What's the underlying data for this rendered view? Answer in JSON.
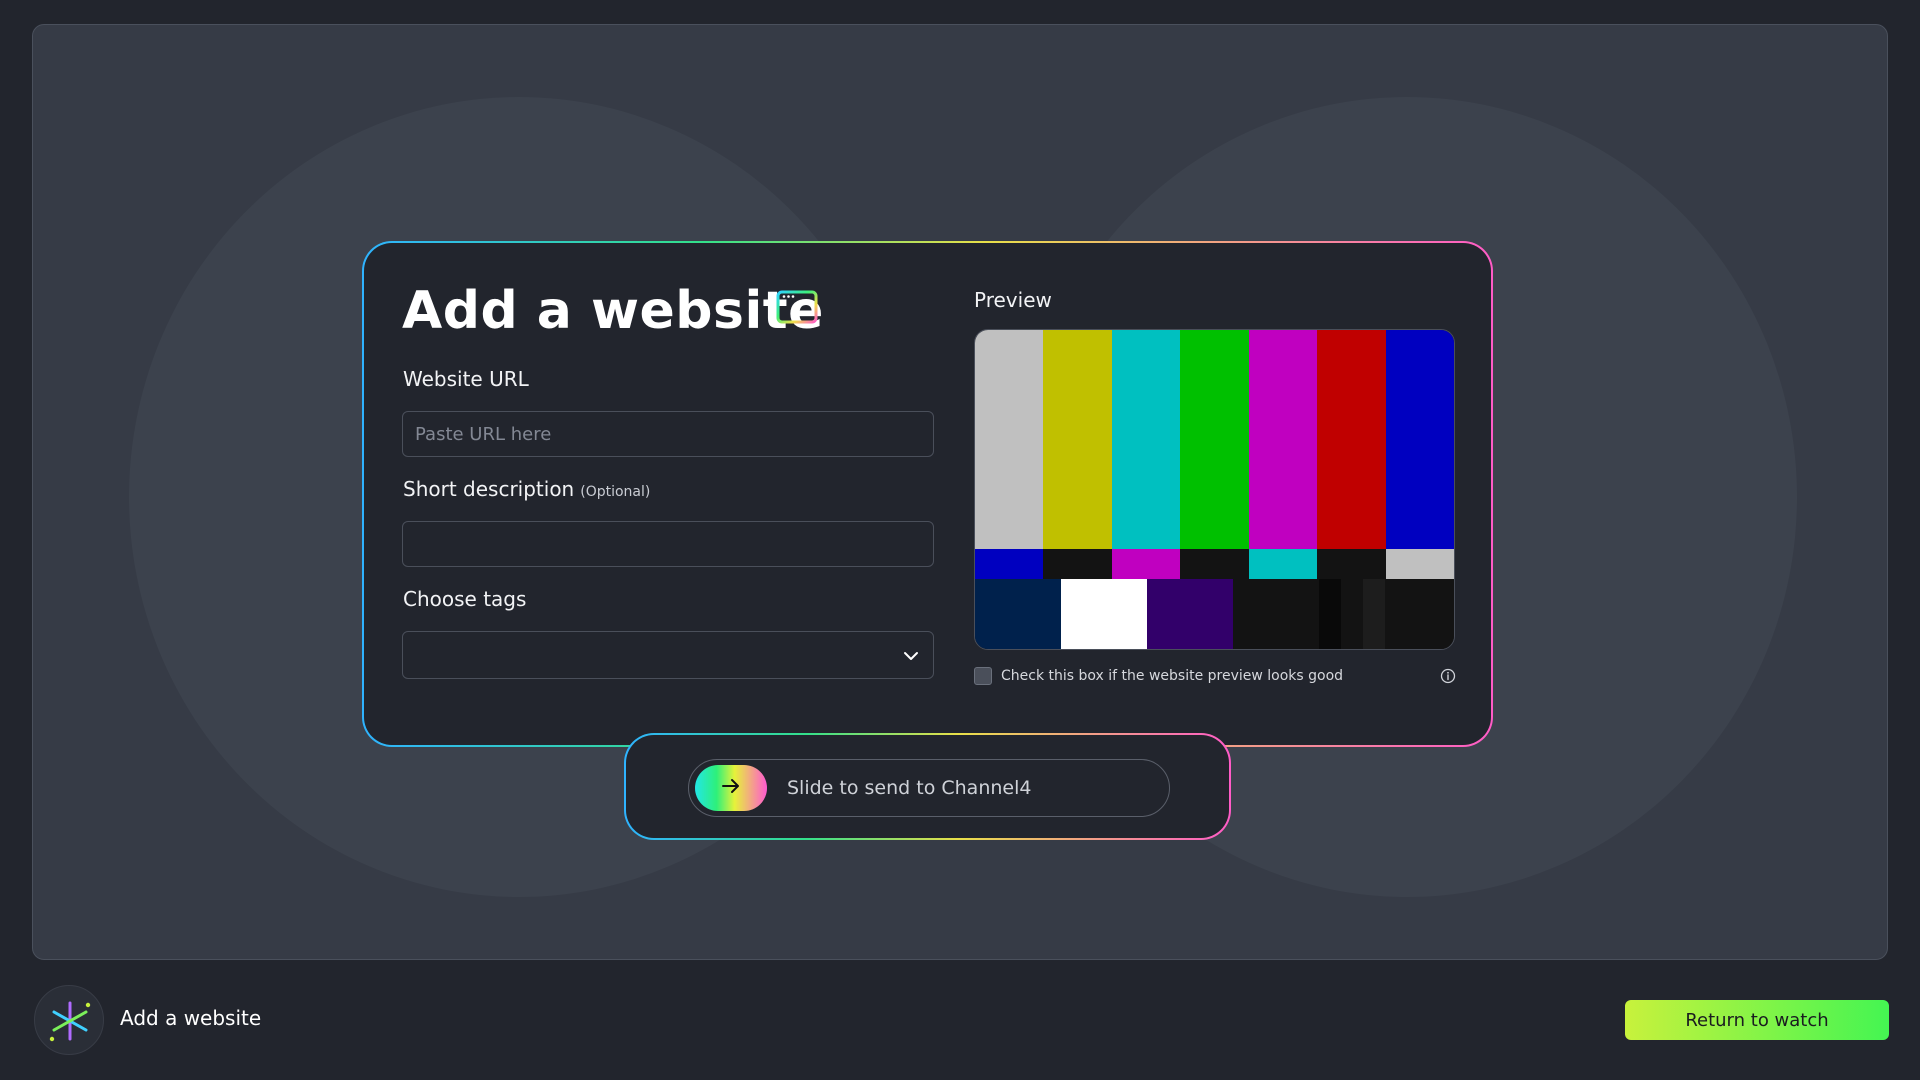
{
  "form": {
    "title": "Add a website",
    "title_icon": "browser-window-icon",
    "url_label": "Website URL",
    "url_placeholder": "Paste URL here",
    "url_value": "",
    "description_label": "Short description",
    "description_optional": "(Optional)",
    "description_value": "",
    "tags_label": "Choose tags",
    "tags_selected": "",
    "tags_icon": "chevron-down-icon"
  },
  "preview": {
    "label": "Preview",
    "top_bar_colors": [
      "#c0c0c0",
      "#c0c000",
      "#00c0c0",
      "#00c000",
      "#c000c0",
      "#c00000",
      "#0000c0"
    ],
    "mid_bar_colors": [
      "#0000c0",
      "#131313",
      "#c000c0",
      "#131313",
      "#00c0c0",
      "#131313",
      "#c0c0c0"
    ],
    "bottom_bar_colors": [
      "#00214c",
      "#ffffff",
      "#32006a",
      "#131313",
      "#131313",
      "#090909",
      "#131313",
      "#1d1d1d",
      "#131313"
    ],
    "checkbox_label": "Check this box if the website preview looks good",
    "checkbox_checked": false,
    "info_icon": "info-icon"
  },
  "slider": {
    "label": "Slide to send to Channel4",
    "knob_icon": "arrow-right-icon"
  },
  "footer": {
    "logo": "spark-logo-icon",
    "title": "Add a website",
    "return_label": "Return to watch"
  },
  "colors": {
    "background": "#22252d",
    "stage": "#363b46",
    "accent_gradient": [
      "#2fb3ff",
      "#33e08a",
      "#e8e049",
      "#ff5bc7"
    ],
    "return_button": [
      "#c8f23c",
      "#44f552"
    ]
  }
}
